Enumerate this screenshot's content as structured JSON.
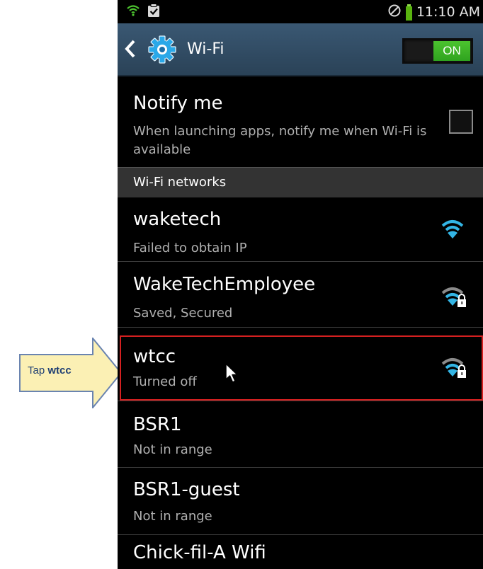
{
  "callout": {
    "prefix": "Tap",
    "target": "wtcc",
    "fill_color": "#fbf0b4",
    "border_color": "#6a84b0"
  },
  "status_bar": {
    "time": "11:10 AM",
    "icons": [
      "wifi-signal-icon",
      "clipboard-check-icon",
      "no-sim-icon",
      "battery-icon"
    ]
  },
  "action_bar": {
    "title": "Wi-Fi",
    "toggle_label": "ON",
    "toggle_state": true
  },
  "notify": {
    "title": "Notify me",
    "subtitle": "When launching apps, notify me when Wi-Fi is available",
    "checked": false
  },
  "section": {
    "label": "Wi-Fi networks"
  },
  "networks": [
    {
      "name": "waketech",
      "status": "Failed to obtain IP",
      "secured": false,
      "signal": "strong"
    },
    {
      "name": "WakeTechEmployee",
      "status": "Saved, Secured",
      "secured": true,
      "signal": "medium"
    },
    {
      "name": "wtcc",
      "status": "Turned off",
      "secured": true,
      "signal": "medium",
      "highlighted": true
    },
    {
      "name": "BSR1",
      "status": "Not in range",
      "secured": false,
      "signal": "none"
    },
    {
      "name": "BSR1-guest",
      "status": "Not in range",
      "secured": false,
      "signal": "none"
    },
    {
      "name": "Chick-fil-A Wifi",
      "status": "",
      "secured": false,
      "signal": "none"
    }
  ],
  "colors": {
    "accent_green": "#3bb425",
    "wifi_blue": "#33b5e5",
    "highlight_red": "#d42020",
    "actionbar": "#33506b"
  }
}
